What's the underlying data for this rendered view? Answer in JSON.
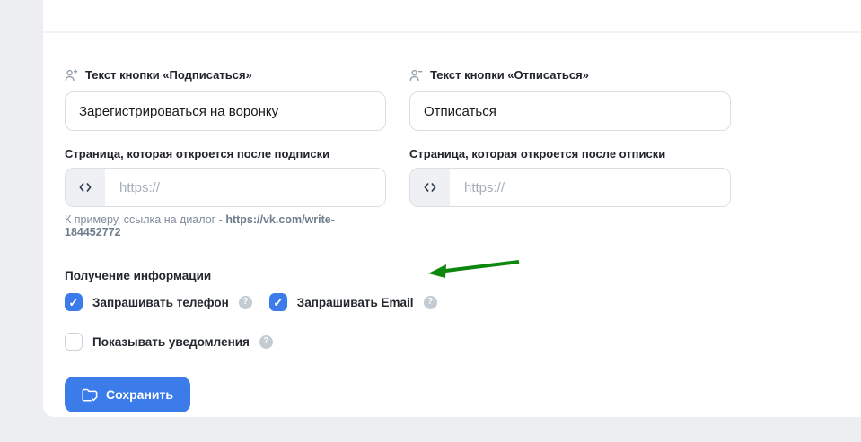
{
  "colors": {
    "accent": "#3b7cea",
    "arrow-green": "#0d870d"
  },
  "form": {
    "subscribe": {
      "label": "Текст кнопки «Подписаться»",
      "value": "Зарегистрироваться на воронку",
      "icon": "user-plus-icon"
    },
    "unsubscribe": {
      "label": "Текст кнопки «Отписаться»",
      "value": "Отписаться",
      "icon": "user-minus-icon"
    },
    "subscribe_page": {
      "label": "Страница, которая откроется после подписки",
      "placeholder": "https://",
      "prefix_icon": "code-icon"
    },
    "unsubscribe_page": {
      "label": "Страница, которая откроется после отписки",
      "placeholder": "https://",
      "prefix_icon": "code-icon"
    },
    "hint": {
      "prefix": "К примеру, ссылка на диалог - ",
      "url": "https://vk.com/write-184452772"
    }
  },
  "info": {
    "title": "Получение информации",
    "help_symbol": "?",
    "check_symbol": "✓",
    "checkboxes": [
      {
        "label": "Запрашивать телефон",
        "checked": true
      },
      {
        "label": "Запрашивать Email",
        "checked": true
      },
      {
        "label": "Показывать уведомления",
        "checked": false
      }
    ]
  },
  "actions": {
    "save": "Сохранить",
    "save_icon": "folder-check-icon"
  },
  "annotation": {
    "icon": "green-arrow-left"
  }
}
